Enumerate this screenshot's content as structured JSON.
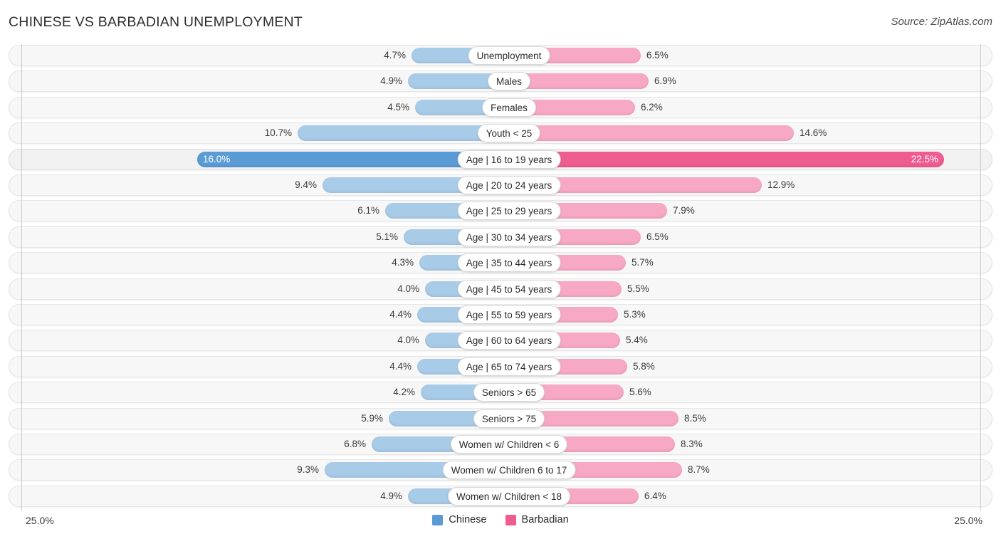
{
  "header": {
    "title": "CHINESE VS BARBADIAN UNEMPLOYMENT",
    "source": "Source: ZipAtlas.com"
  },
  "footer": {
    "axis_left": "25.0%",
    "axis_right": "25.0%"
  },
  "legend": {
    "items": [
      {
        "label": "Chinese",
        "color": "#5b9bd5"
      },
      {
        "label": "Barbadian",
        "color": "#ee5c90"
      }
    ]
  },
  "colors": {
    "blue_normal": "#a8cbe8",
    "pink_normal": "#f7a8c4",
    "blue_highlight": "#5b9bd5",
    "pink_highlight": "#ee5c90",
    "row_track": "#f7f7f7",
    "row_track_highlight": "#f2f2f2",
    "axis_line": "#c9c9c9"
  },
  "chart_data": {
    "type": "bar",
    "subtype": "diverging-butterfly",
    "title": "CHINESE VS BARBADIAN UNEMPLOYMENT",
    "xlabel": "",
    "ylabel": "",
    "unit": "percent",
    "xlim": [
      25.0,
      25.0
    ],
    "axis_max_left": 25.0,
    "axis_max_right": 25.0,
    "grid": false,
    "legend_position": "bottom-center",
    "categories": [
      "Unemployment",
      "Males",
      "Females",
      "Youth < 25",
      "Age | 16 to 19 years",
      "Age | 20 to 24 years",
      "Age | 25 to 29 years",
      "Age | 30 to 34 years",
      "Age | 35 to 44 years",
      "Age | 45 to 54 years",
      "Age | 55 to 59 years",
      "Age | 60 to 64 years",
      "Age | 65 to 74 years",
      "Seniors > 65",
      "Seniors > 75",
      "Women w/ Children < 6",
      "Women w/ Children 6 to 17",
      "Women w/ Children < 18"
    ],
    "series": [
      {
        "name": "Chinese",
        "side": "left",
        "color": "#a8cbe8",
        "values": [
          4.7,
          4.9,
          4.5,
          10.7,
          16.0,
          9.4,
          6.1,
          5.1,
          4.3,
          4.0,
          4.4,
          4.0,
          4.4,
          4.2,
          5.9,
          6.8,
          9.3,
          4.9
        ],
        "labels": [
          "4.7%",
          "4.9%",
          "4.5%",
          "10.7%",
          "16.0%",
          "9.4%",
          "6.1%",
          "5.1%",
          "4.3%",
          "4.0%",
          "4.4%",
          "4.0%",
          "4.4%",
          "4.2%",
          "5.9%",
          "6.8%",
          "9.3%",
          "4.9%"
        ]
      },
      {
        "name": "Barbadian",
        "side": "right",
        "color": "#f7a8c4",
        "values": [
          6.5,
          6.9,
          6.2,
          14.6,
          22.5,
          12.9,
          7.9,
          6.5,
          5.7,
          5.5,
          5.3,
          5.4,
          5.8,
          5.6,
          8.5,
          8.3,
          8.7,
          6.4
        ],
        "labels": [
          "6.5%",
          "6.9%",
          "6.2%",
          "14.6%",
          "22.5%",
          "12.9%",
          "7.9%",
          "6.5%",
          "5.7%",
          "5.5%",
          "5.3%",
          "5.4%",
          "5.8%",
          "5.6%",
          "8.5%",
          "8.3%",
          "8.7%",
          "6.4%"
        ]
      }
    ],
    "highlighted_row_index": 4
  }
}
